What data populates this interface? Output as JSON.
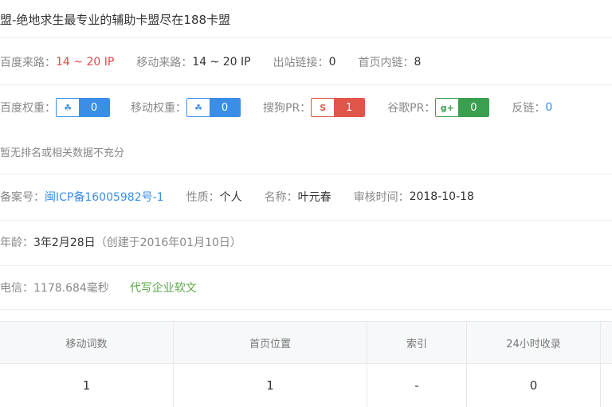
{
  "title": "盟-绝地求生最专业的辅助卡盟尽在188卡盟",
  "stats_row": {
    "baidu_traffic_label": "百度来路：",
    "baidu_traffic_value": "14 ~ 20 IP",
    "mobile_traffic_label": "移动来路：",
    "mobile_traffic_value": "14 ~ 20 IP",
    "outlinks_label": "出站链接：",
    "outlinks_value": "0",
    "inlinks_label": "首页内链：",
    "inlinks_value": "8"
  },
  "weights_row": {
    "baidu_weight_label": "百度权重：",
    "baidu_weight_value": "0",
    "mobile_weight_label": "移动权重：",
    "mobile_weight_value": "0",
    "sogou_pr_label": "搜狗PR：",
    "sogou_pr_value": "1",
    "google_pr_label": "谷歌PR：",
    "google_pr_value": "0",
    "backlinks_label": "反链：",
    "backlinks_value": "0",
    "icons": {
      "baidu": "baidu-paw-icon",
      "mobile": "mobile-paw-icon",
      "sogou": "sogou-s-icon",
      "google": "google-g-icon"
    },
    "colors": {
      "blue": "#3a8ee6",
      "red": "#e0554a",
      "green": "#3aa050"
    }
  },
  "note": "暂无排名或相关数据不充分",
  "icp_row": {
    "icp_label": "备案号：",
    "icp_value": "闽ICP备16005982号-1",
    "nature_label": "性质：",
    "nature_value": "个人",
    "name_label": "名称：",
    "name_value": "叶元春",
    "review_label": "审核时间：",
    "review_value": "2018-10-18"
  },
  "age_row": {
    "label": "年龄：",
    "value": "3年2月28日",
    "created": "（创建于2016年01月10日）"
  },
  "speed_row": {
    "label": "电信：",
    "value": "1178.684毫秒",
    "link": "代写企业软文"
  },
  "table": {
    "headers": [
      "移动词数",
      "首页位置",
      "索引",
      "24小时收录"
    ],
    "rows": [
      [
        "1",
        "1",
        "-",
        "0"
      ]
    ]
  }
}
